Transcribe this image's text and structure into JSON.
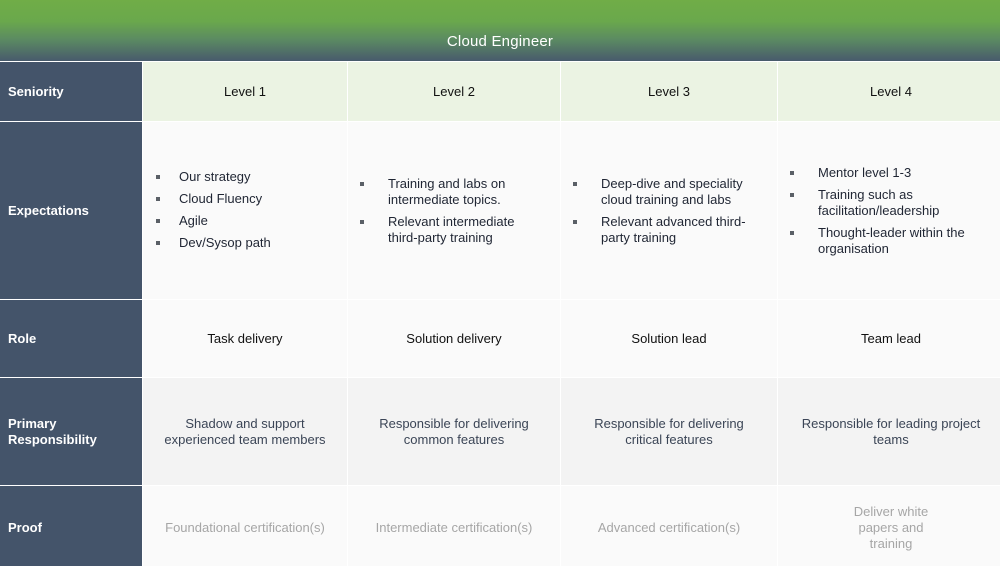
{
  "title": "Cloud Engineer",
  "row_labels": {
    "seniority": "Seniority",
    "expectations": "Expectations",
    "role": "Role",
    "primary_responsibility": "Primary Responsibility",
    "proof": "Proof"
  },
  "levels": [
    {
      "name": "Level 1",
      "expectations": [
        "Our strategy",
        "Cloud Fluency",
        "Agile",
        "Dev/Sysop path"
      ],
      "role": "Task delivery",
      "primary_responsibility": "Shadow and support experienced team members",
      "proof": "Foundational certification(s)"
    },
    {
      "name": "Level 2",
      "expectations": [
        "Training and labs on intermediate topics.",
        "Relevant intermediate third-party training"
      ],
      "role": "Solution delivery",
      "primary_responsibility": "Responsible for delivering common features",
      "proof": "Intermediate certification(s)"
    },
    {
      "name": "Level 3",
      "expectations": [
        "Deep-dive and speciality cloud training and labs",
        "Relevant advanced third-party training"
      ],
      "role": "Solution lead",
      "primary_responsibility": "Responsible for delivering critical features",
      "proof": "Advanced certification(s)"
    },
    {
      "name": "Level 4",
      "expectations": [
        "Mentor level 1-3",
        "Training such as facilitation/leadership",
        "Thought-leader within the organisation"
      ],
      "role": "Team lead",
      "primary_responsibility": "Responsible for leading project teams",
      "proof": "Deliver white papers and training"
    }
  ],
  "colors": {
    "header_green": "#70ad47",
    "label_slate": "#44546a",
    "level_header_bg": "#ebf3e3",
    "proof_text": "#a6a6a6"
  }
}
